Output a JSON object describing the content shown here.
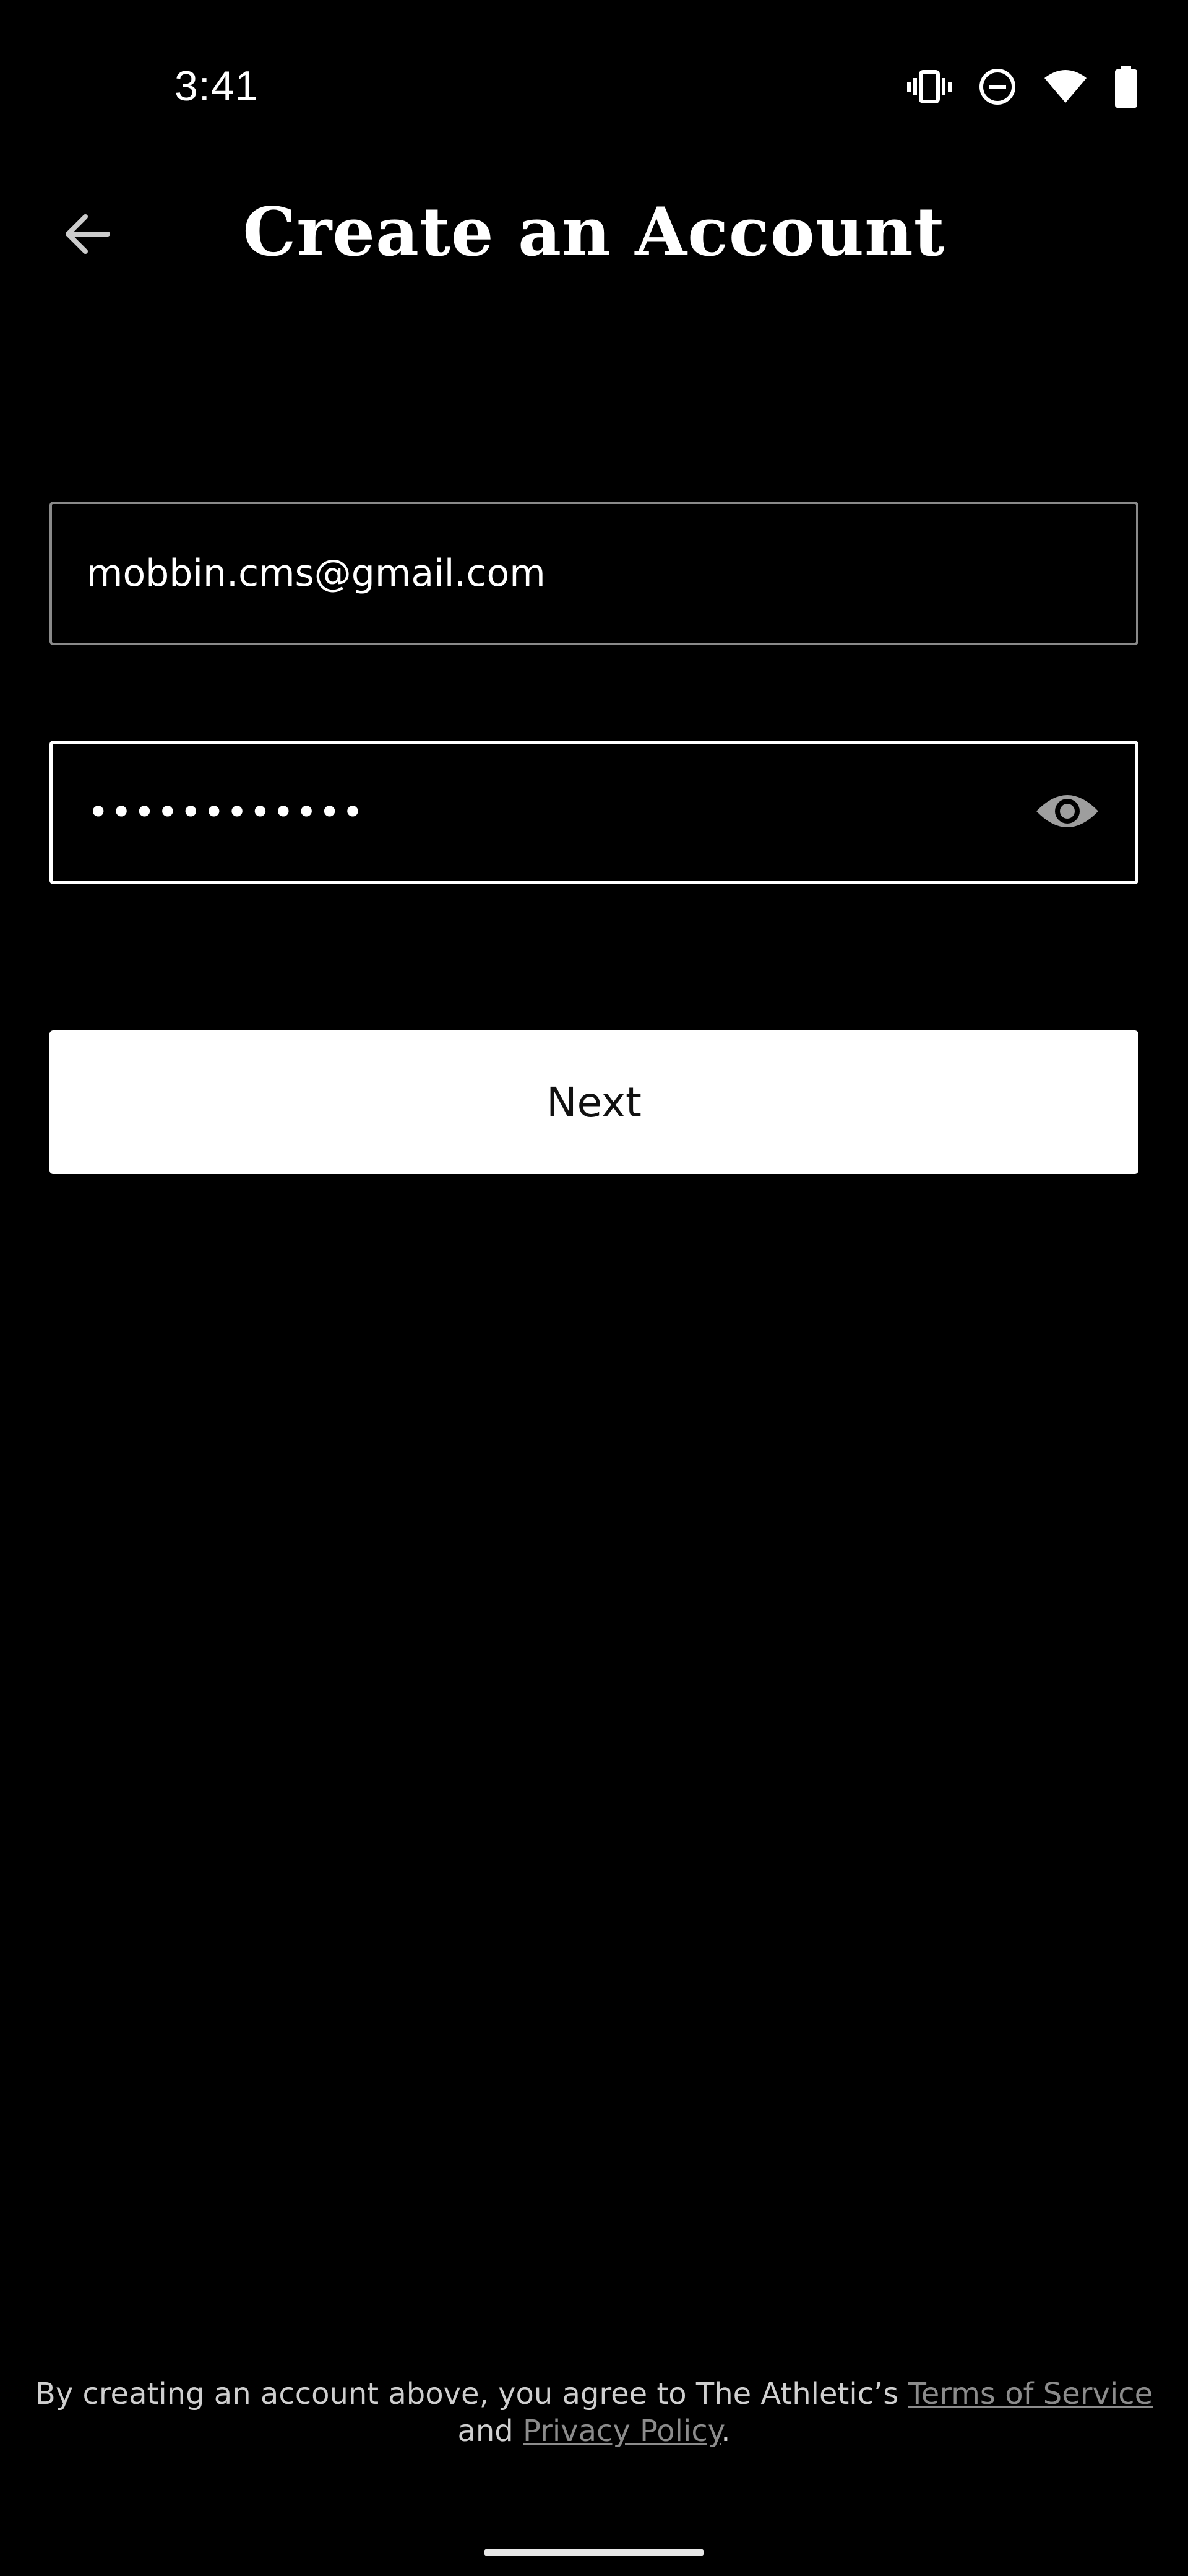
{
  "status_bar": {
    "time": "3:41",
    "icons": [
      "vibrate-icon",
      "do-not-disturb-icon",
      "wifi-icon",
      "battery-icon"
    ]
  },
  "app_bar": {
    "back_icon": "arrow-left-icon",
    "title": "Create an Account"
  },
  "form": {
    "email_value": "mobbin.cms@gmail.com",
    "password_masked": "••••••••••••",
    "visibility_icon": "eye-icon"
  },
  "actions": {
    "next_label": "Next"
  },
  "legal": {
    "text_before": "By creating an account above, you agree to The Athletic’s ",
    "terms_link": "Terms of Service",
    "text_middle": " and ",
    "privacy_link": "Privacy Policy",
    "text_after": "."
  },
  "colors": {
    "background": "#000000",
    "text": "#ffffff",
    "button_bg": "#ffffff",
    "link": "#8c8c8c"
  }
}
